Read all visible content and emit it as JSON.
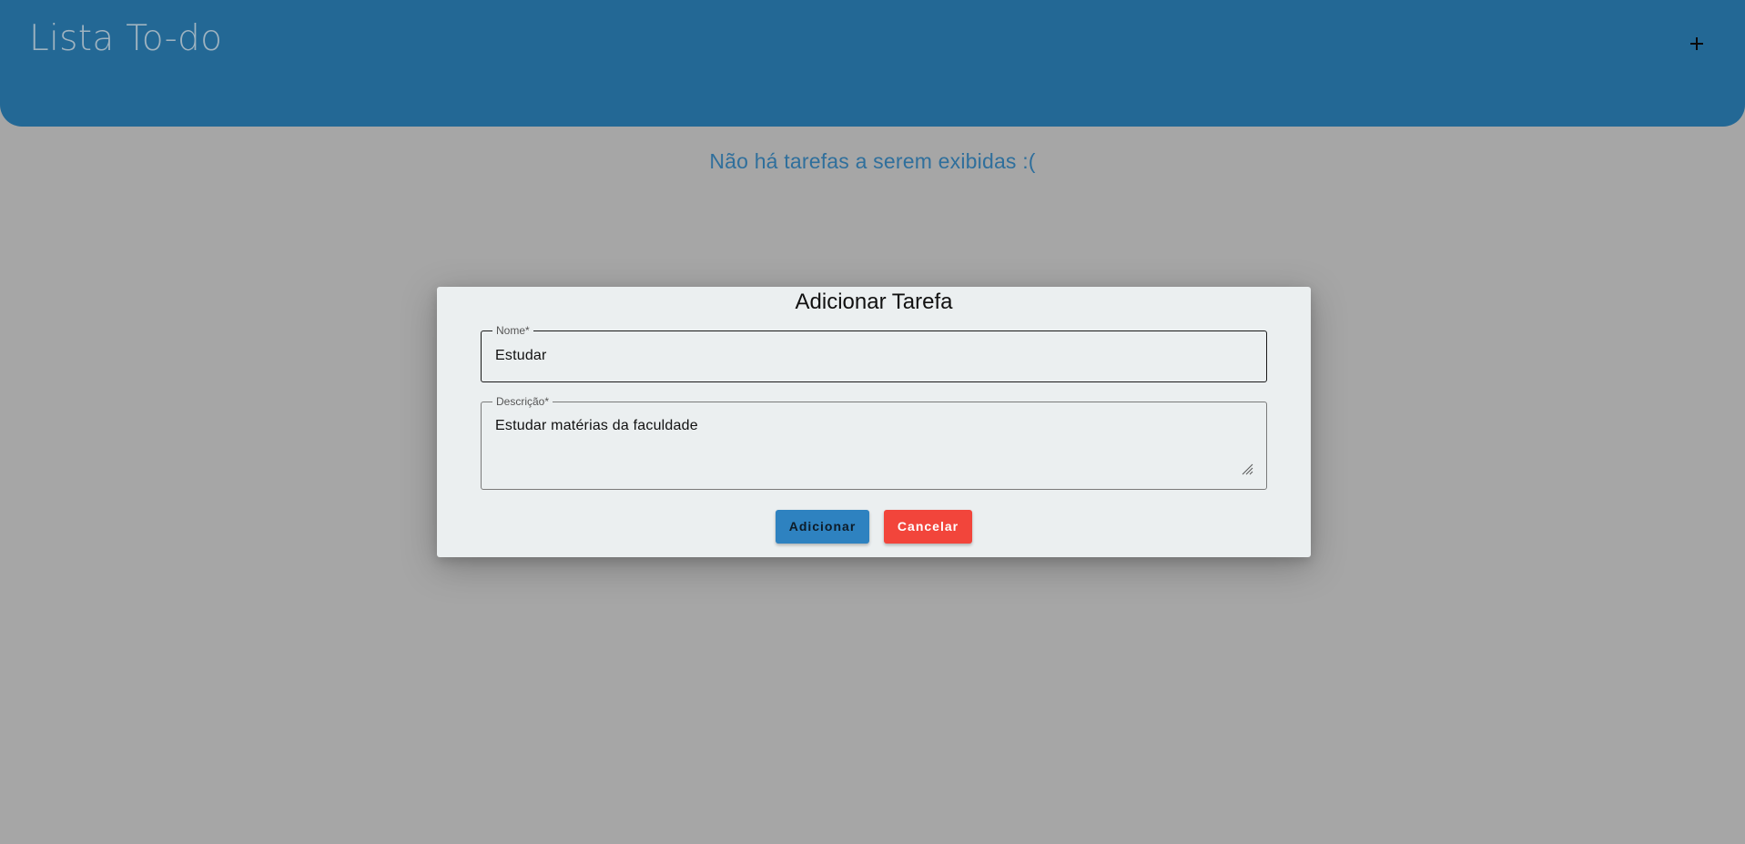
{
  "header": {
    "title": "Lista To-do",
    "add_icon": "plus-icon"
  },
  "main": {
    "empty_message": "Não há tarefas a serem exibidas :("
  },
  "dialog": {
    "title": "Adicionar Tarefa",
    "name_field": {
      "label": "Nome*",
      "value": "Estudar"
    },
    "description_field": {
      "label": "Descrição*",
      "value": "Estudar matérias da faculdade"
    },
    "buttons": {
      "add_label": "Adicionar",
      "cancel_label": "Cancelar"
    }
  },
  "colors": {
    "header_bg": "#236895",
    "backdrop": "#a6a6a6",
    "dialog_bg": "#ebeff0",
    "primary_button": "#2e82c0",
    "danger_button": "#f2453b",
    "message_text": "#2f6f9c"
  }
}
